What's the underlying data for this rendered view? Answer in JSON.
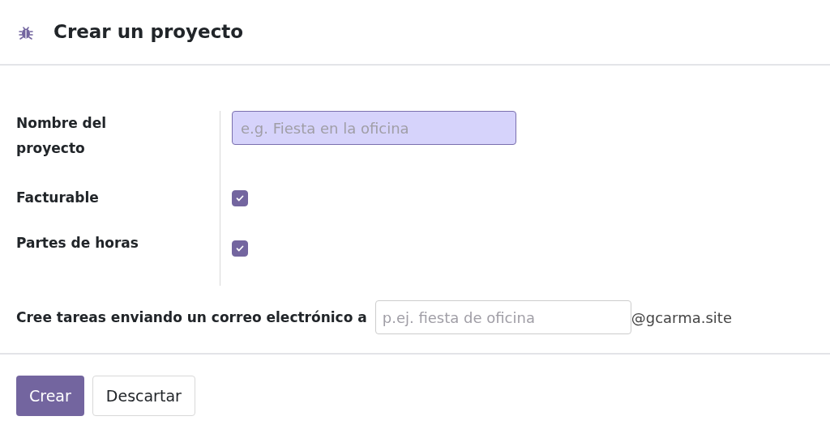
{
  "dialog": {
    "title": "Crear un proyecto"
  },
  "fields": [
    {
      "kind": "text",
      "label": "Nombre del proyecto",
      "placeholder": "e.g. Fiesta en la oficina",
      "required": true
    },
    {
      "kind": "checkbox",
      "label": "Facturable",
      "checked": true
    },
    {
      "kind": "checkbox",
      "label": "Partes de horas",
      "checked": true
    }
  ],
  "email_alias": {
    "label": "Cree tareas enviando un correo electrónico a",
    "placeholder": "p.ej. fiesta de oficina",
    "domain": "@gcarma.site"
  },
  "buttons": [
    {
      "label": "Crear",
      "kind": "primary"
    },
    {
      "label": "Descartar",
      "kind": "secondary"
    }
  ]
}
